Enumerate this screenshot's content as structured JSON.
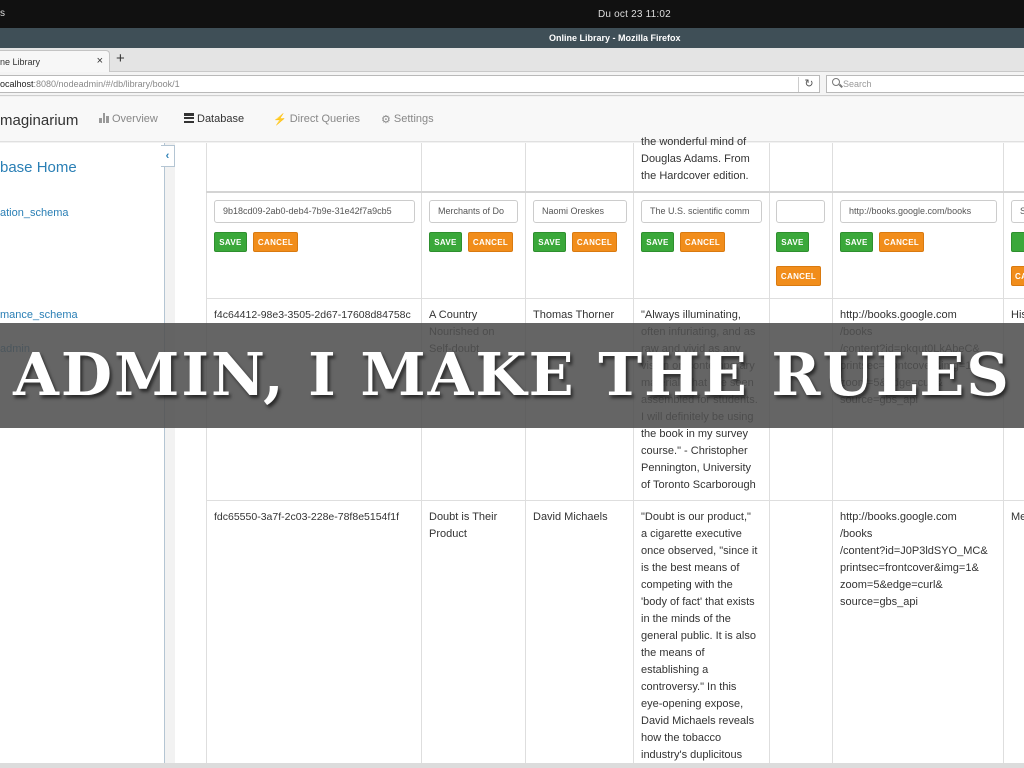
{
  "os": {
    "clock": "Du oct 23    11:02",
    "left_fragment": "s"
  },
  "window": {
    "title": "Online Library - Mozilla Firefox"
  },
  "tab": {
    "title": "ne Library",
    "close": "×",
    "new": "+"
  },
  "nav": {
    "url_host": "ocalhost",
    "url_path": ":8080/nodeadmin/#/db/library/book/1",
    "reload": "↻",
    "search_placeholder": "Search"
  },
  "app": {
    "brand": "maginarium",
    "menu": {
      "overview": "Overview",
      "database": "Database",
      "queries": "Direct Queries",
      "settings": "Settings"
    }
  },
  "sidebar": {
    "title": "base Home",
    "links": [
      "ation_schema",
      "mance_schema",
      "admin"
    ],
    "collapse": "‹"
  },
  "table": {
    "row0": {
      "desc": "the wonderful mind of\nDouglas Adams. From\nthe Hardcover edition."
    },
    "edit": {
      "id": "9b18cd09-2ab0-deb4-7b9e-31e42f7a9cb5",
      "title": "Merchants of Do",
      "author": "Naomi Oreskes",
      "desc": "The U.S. scientific comm",
      "extra": "",
      "url": "http://books.google.com/books",
      "last": "S",
      "save": "SAVE",
      "cancel": "CANCEL",
      "cancel_partial": "CA"
    },
    "row2": {
      "id": "f4c64412-98e3-3505-2d67-17608d84758c",
      "title": "A Country\nNourished on\nSelf-doubt",
      "author": "Thomas Thorner",
      "desc": "\"Always illuminating,\noften infuriating, and as\nraw and vivid as any\nvision on contemporary\nmaterials that I've seen\nassembled for students.\nI will definitely be using\nthe book in my survey\ncourse.\" - Christopher\nPennington, University\nof Toronto Scarborough",
      "url": "http://books.google.com\n/books\n/content?id=pkqut0LkAbeC&\nprintsec=frontcover&img=1&\nzoom=5&edge=curl&\nsource=gbs_api",
      "last": "His"
    },
    "row3": {
      "id": "fdc65550-3a7f-2c03-228e-78f8e5154f1f",
      "title": "Doubt is Their\nProduct",
      "author": "David Michaels",
      "desc": "\"Doubt is our product,\"\na cigarette executive\nonce observed, \"since it\nis the best means of\ncompeting with the\n'body of fact' that exists\nin the minds of the\ngeneral public. It is also\nthe means of\nestablishing a\ncontroversy.\" In this\neye-opening expose,\nDavid Michaels reveals\nhow the tobacco\nindustry's duplicitous",
      "url": "http://books.google.com\n/books\n/content?id=J0P3ldSYO_MC&\nprintsec=frontcover&img=1&\nzoom=5&edge=curl&\nsource=gbs_api",
      "last": "Me"
    }
  },
  "banner": {
    "text": "ADMIN, I MAKE THE RULES"
  }
}
